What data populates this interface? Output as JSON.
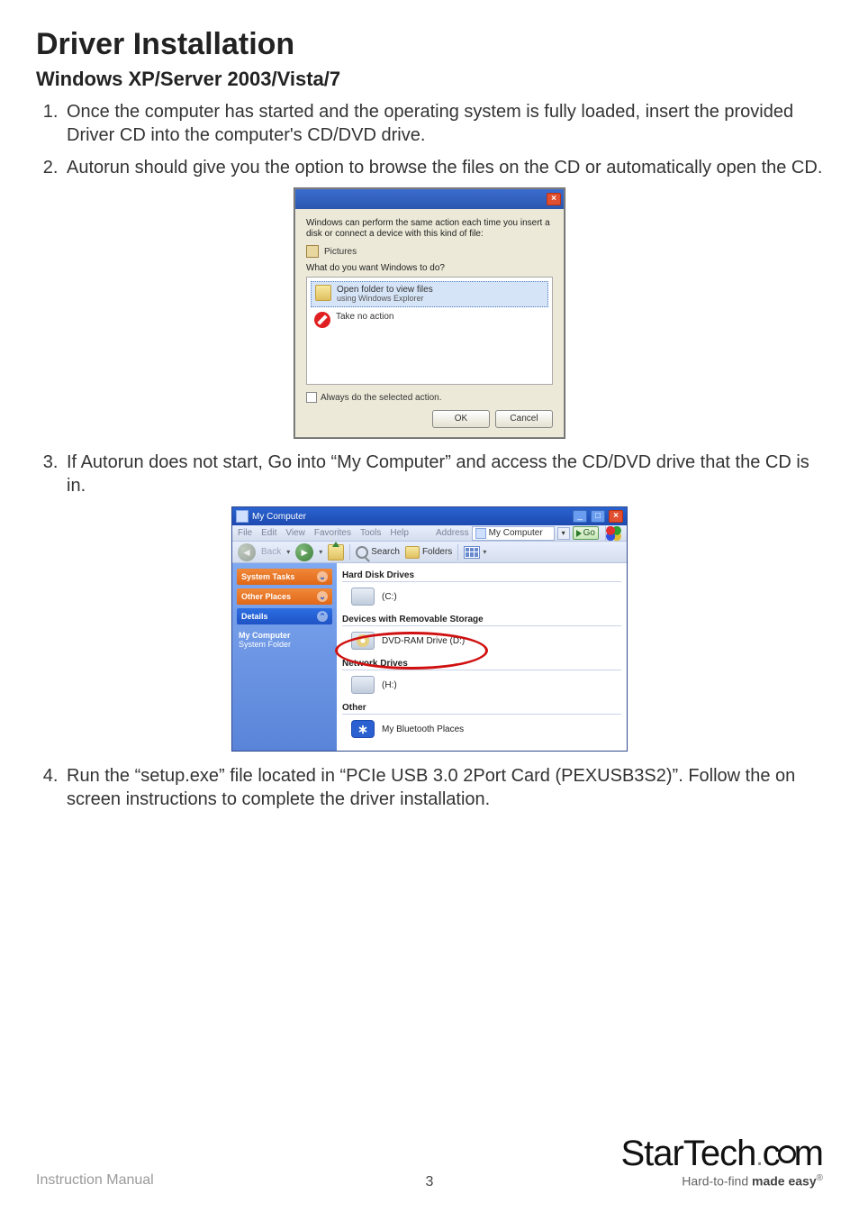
{
  "heading": "Driver Installation",
  "subheading": "Windows XP/Server 2003/Vista/7",
  "steps": {
    "s1": "Once the computer has started and the operating system is fully loaded, insert the provided Driver CD into the computer's CD/DVD drive.",
    "s2": "Autorun should give you the option to browse the files on the CD or automatically open the CD.",
    "s3": "If Autorun does not start, Go into “My Computer” and access the CD/DVD drive that the CD is in.",
    "s4": "Run the “setup.exe” file located in “PCIe USB 3.0 2Port Card (PEXUSB3S2)”.  Follow the on screen instructions to complete the driver installation."
  },
  "autorun": {
    "msg": "Windows can perform the same action each time you insert a disk or connect a device with this kind of file:",
    "pictures": "Pictures",
    "prompt": "What do you want Windows to do?",
    "opt_open_title": "Open folder to view files",
    "opt_open_sub": "using Windows Explorer",
    "opt_noaction": "Take no action",
    "always": "Always do the selected action.",
    "ok": "OK",
    "cancel": "Cancel"
  },
  "explorer": {
    "title": "My Computer",
    "menu": {
      "file": "File",
      "edit": "Edit",
      "view": "View",
      "favorites": "Favorites",
      "tools": "Tools",
      "help": "Help"
    },
    "address_label": "Address",
    "address_value": "My Computer",
    "go": "Go",
    "back": "Back",
    "search": "Search",
    "folders": "Folders",
    "sidebar": {
      "system_tasks": "System Tasks",
      "other_places": "Other Places",
      "details": "Details",
      "detail_title": "My Computer",
      "detail_sub": "System Folder"
    },
    "groups": {
      "hdd": "Hard Disk Drives",
      "removable": "Devices with Removable Storage",
      "network": "Network Drives",
      "other": "Other"
    },
    "drives": {
      "c": "(C:)",
      "dvd": "DVD-RAM Drive (D:)",
      "h": "(H:)",
      "bt": "My Bluetooth Places"
    }
  },
  "footer": {
    "manual": "Instruction Manual",
    "page": "3",
    "logo_a": "Star",
    "logo_b": "Tech",
    "logo_c": "c",
    "logo_d": "m",
    "tag_a": "Hard-to-find ",
    "tag_b": "made easy"
  }
}
